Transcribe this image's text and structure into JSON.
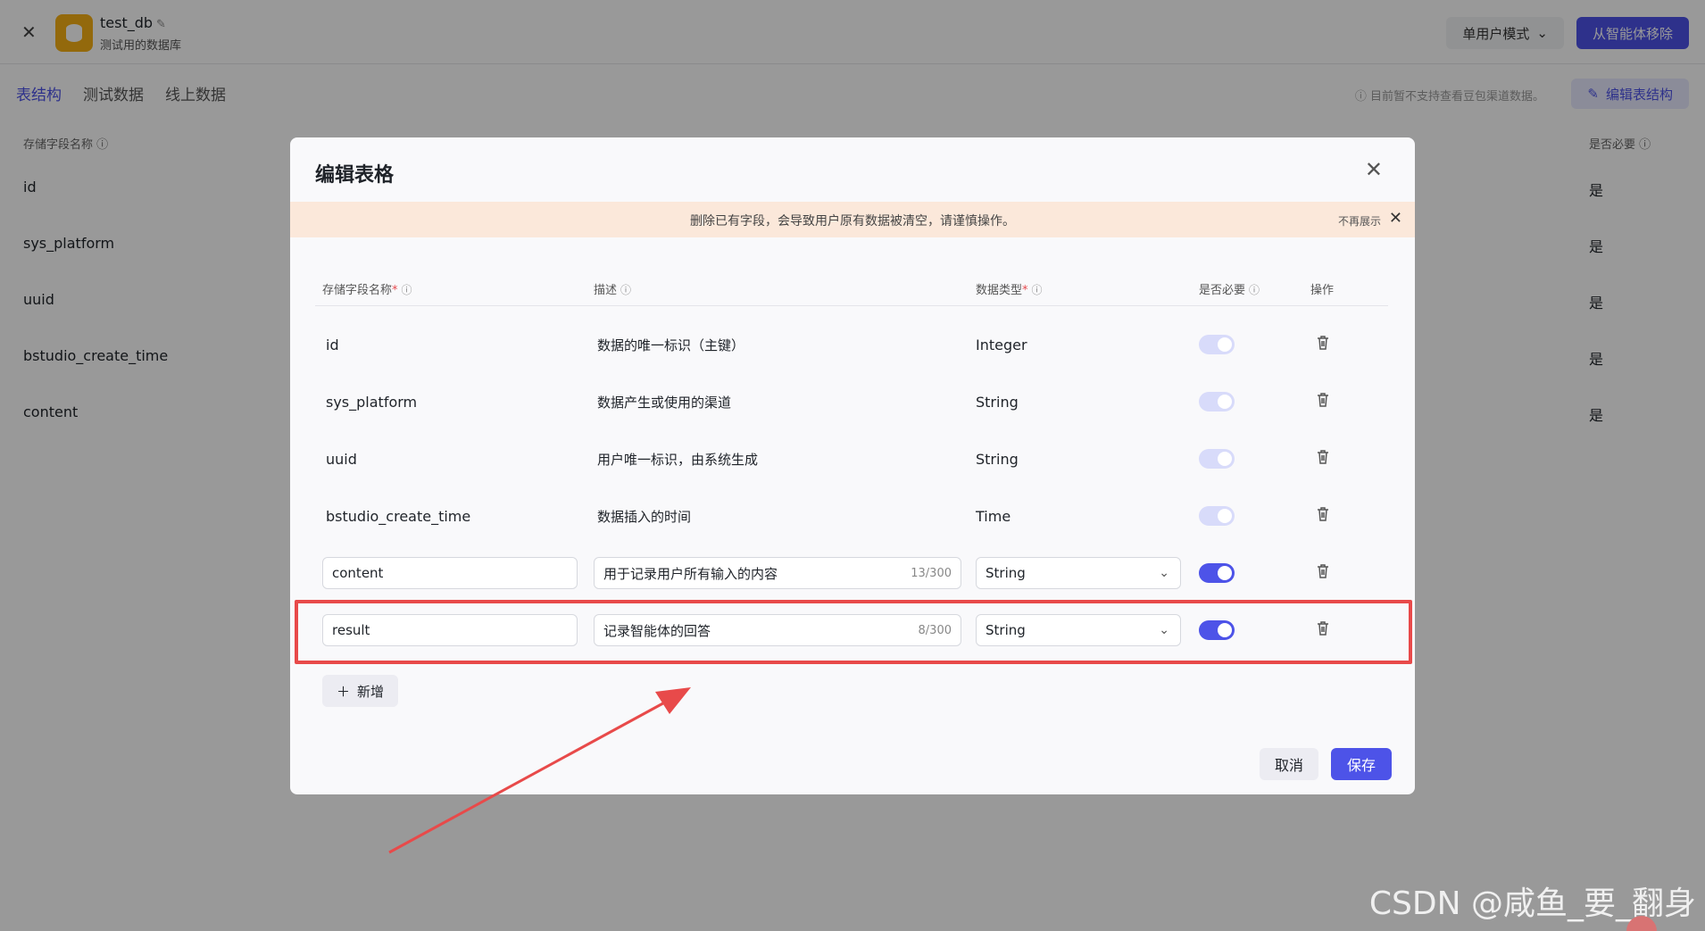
{
  "header": {
    "db_name": "test_db",
    "db_desc": "测试用的数据库",
    "mode_label": "单用户模式",
    "remove_label": "从智能体移除"
  },
  "tabs": [
    {
      "label": "表结构",
      "active": true
    },
    {
      "label": "测试数据",
      "active": false
    },
    {
      "label": "线上数据",
      "active": false
    }
  ],
  "notice": "目前暂不支持查看豆包渠道数据。",
  "edit_structure_label": "编辑表结构",
  "bg_table": {
    "head_field": "存储字段名称",
    "head_required": "是否必要",
    "rows": [
      {
        "name": "id",
        "required": "是"
      },
      {
        "name": "sys_platform",
        "required": "是"
      },
      {
        "name": "uuid",
        "required": "是"
      },
      {
        "name": "bstudio_create_time",
        "required": "是"
      },
      {
        "name": "content",
        "required": "是"
      }
    ]
  },
  "modal": {
    "title": "编辑表格",
    "warning": "删除已有字段，会导致用户原有数据被清空，请谨慎操作。",
    "warning_dismiss": "不再展示",
    "columns": {
      "field": "存储字段名称",
      "desc": "描述",
      "type": "数据类型",
      "required": "是否必要",
      "ops": "操作"
    },
    "rows": [
      {
        "field": "id",
        "desc": "数据的唯一标识（主键）",
        "type": "Integer"
      },
      {
        "field": "sys_platform",
        "desc": "数据产生或使用的渠道",
        "type": "String"
      },
      {
        "field": "uuid",
        "desc": "用户唯一标识，由系统生成",
        "type": "String"
      },
      {
        "field": "bstudio_create_time",
        "desc": "数据插入的时间",
        "type": "Time"
      }
    ],
    "editable_rows": [
      {
        "field": "content",
        "desc": "用于记录用户所有输入的内容",
        "count": "13/300",
        "type": "String"
      },
      {
        "field": "result",
        "desc": "记录智能体的回答",
        "count": "8/300",
        "type": "String"
      }
    ],
    "add_label": "新增",
    "cancel_label": "取消",
    "save_label": "保存"
  },
  "watermark": "CSDN @咸鱼_要_翻身",
  "colors": {
    "accent": "#4d53e8",
    "highlight": "#e84a4a",
    "warning_bg": "#fbe8da"
  }
}
